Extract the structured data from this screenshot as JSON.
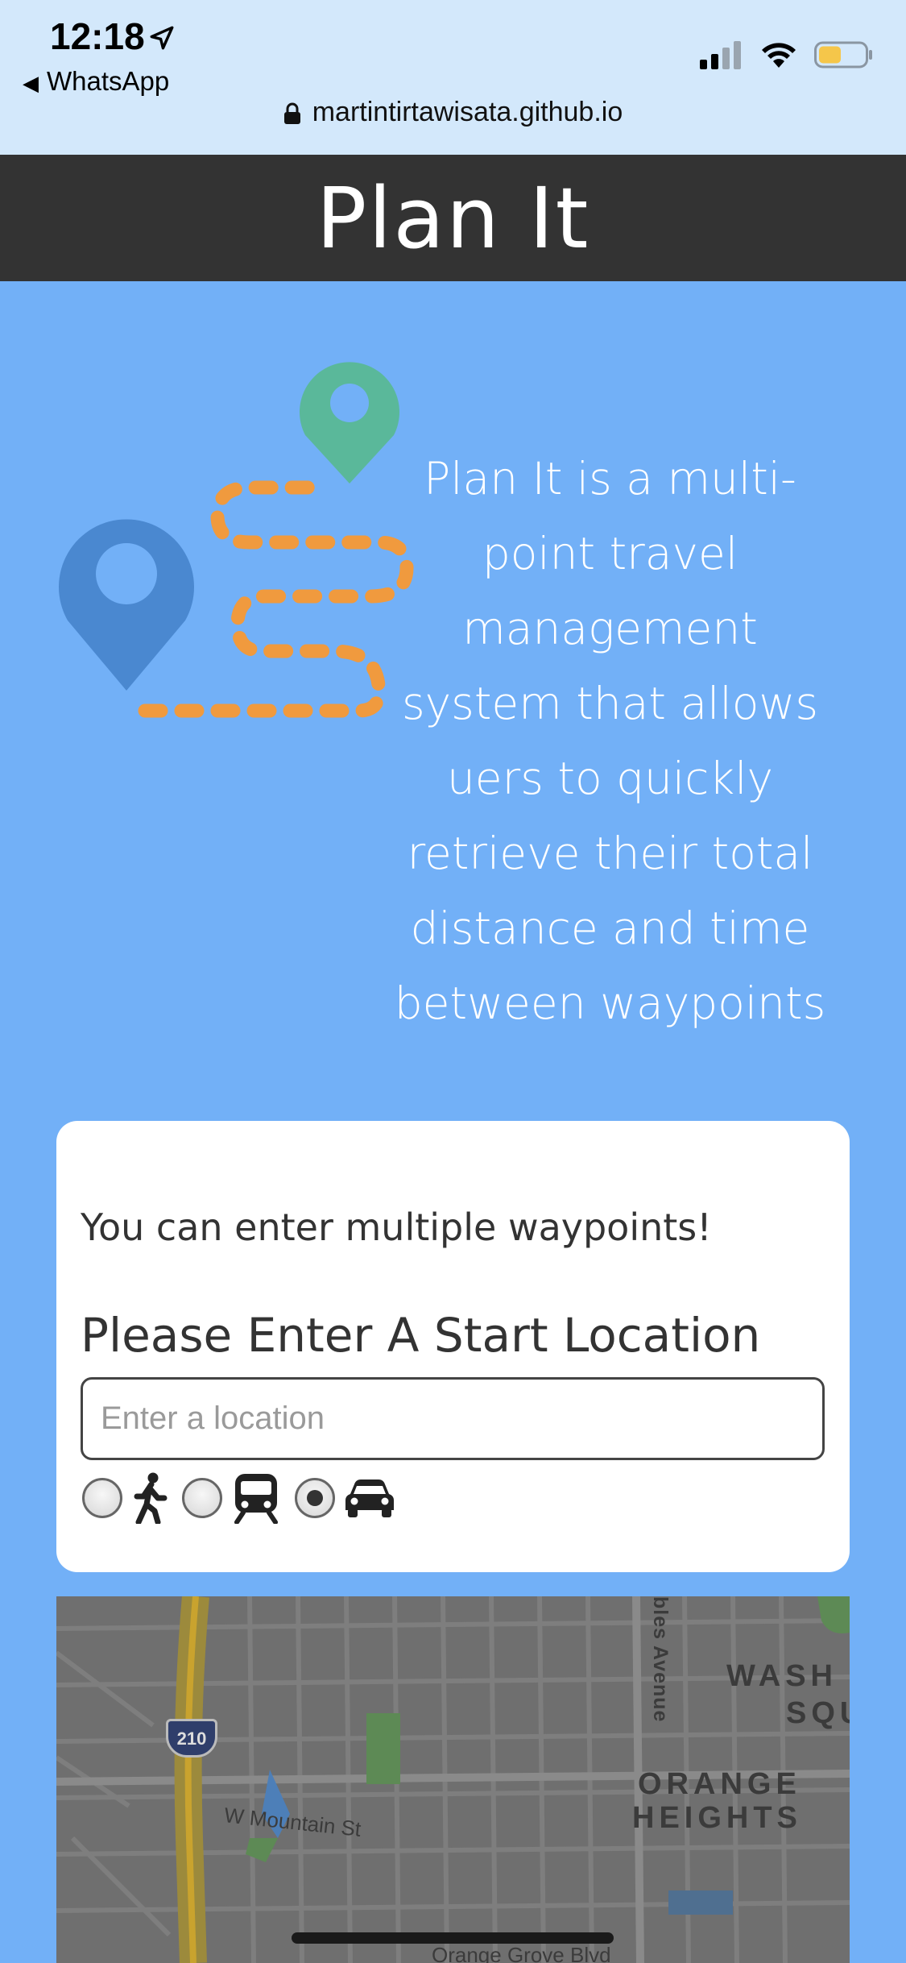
{
  "status_bar": {
    "time": "12:18",
    "back_app": "WhatsApp",
    "url": "martintirtawisata.github.io"
  },
  "header": {
    "title": "Plan It"
  },
  "hero": {
    "description": "Plan It is a multi-point travel management system that allows uers to quickly retrieve their total distance and time between waypoints"
  },
  "form": {
    "hint": "You can enter multiple waypoints!",
    "start_label": "Please Enter A Start Location",
    "start_input": {
      "placeholder": "Enter a location",
      "value": ""
    },
    "travel_modes": [
      {
        "icon": "walking-icon",
        "selected": false
      },
      {
        "icon": "train-icon",
        "selected": false
      },
      {
        "icon": "car-icon",
        "selected": true
      }
    ]
  },
  "map": {
    "labels": [
      "bles Avenue",
      "WASH",
      "SQU",
      "ORANGE",
      "HEIGHTS",
      "W Mountain St",
      "Orange Grove Blvd"
    ],
    "shield": "210"
  },
  "colors": {
    "page_bg": "#72b0f7",
    "header_bg": "#333333",
    "status_bg": "#d3e8fb",
    "pin_green": "#5ab89a",
    "pin_blue": "#4a88d0",
    "route_orange": "#f09a3e"
  }
}
